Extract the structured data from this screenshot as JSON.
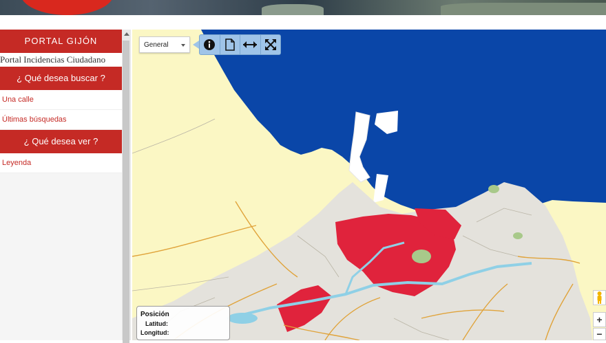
{
  "sidebar": {
    "title": "PORTAL GIJÓN",
    "subtitle": "Portal Incidencias Ciudadano",
    "sections": [
      {
        "heading": "¿ Qué desea buscar ?",
        "links": [
          "Una calle",
          "Últimas búsquedas"
        ]
      },
      {
        "heading": "¿ Qué desea ver ?",
        "links": [
          "Leyenda"
        ]
      }
    ]
  },
  "map": {
    "layer_select": "General",
    "toolbar": [
      "info-icon",
      "document-icon",
      "horizontal-arrows-icon",
      "fullscreen-icon"
    ],
    "position_panel": {
      "title": "Posición",
      "lat_label": "Latitud:",
      "lon_label": "Longitud:"
    },
    "zoom_in": "+",
    "zoom_out": "−"
  },
  "colors": {
    "accent": "#c52a25",
    "sea": "#0a46a8",
    "land": "#fbf7c4",
    "urban": "#e0233c",
    "toolbar": "#9fc4e8"
  }
}
